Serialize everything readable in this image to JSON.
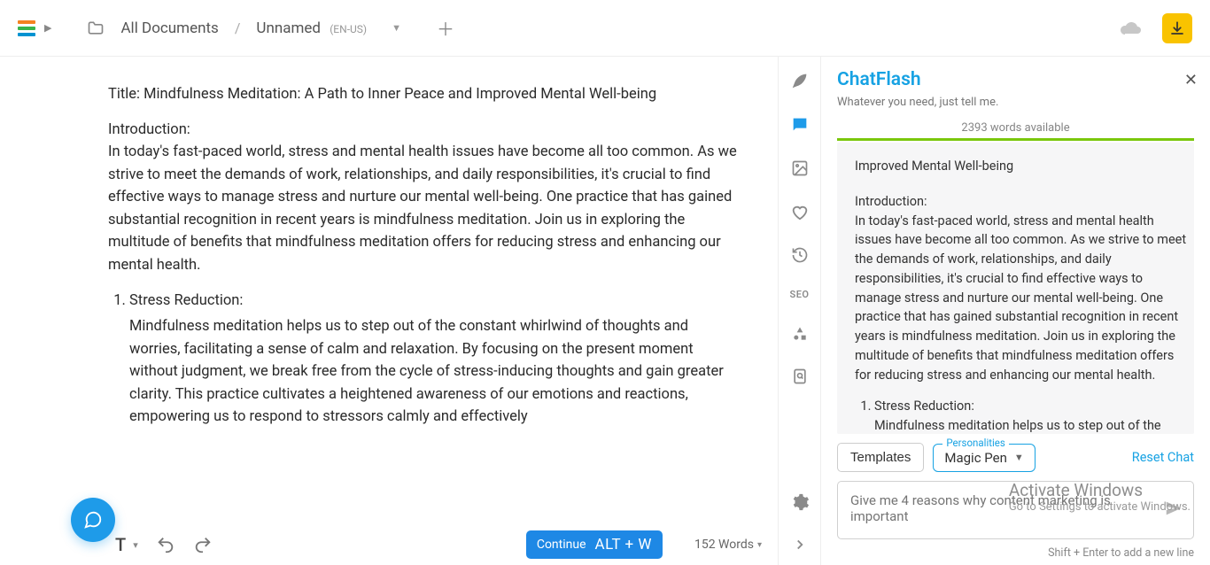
{
  "header": {
    "breadcrumb_root": "All Documents",
    "breadcrumb_current": "Unnamed",
    "lang_tag": "(EN-US)"
  },
  "editor": {
    "title_line": "Title: Mindfulness Meditation: A Path to Inner Peace and Improved Mental Well-being",
    "intro_label": "Introduction:",
    "intro_body": "In today's fast-paced world, stress and mental health issues have become all too common. As we strive to meet the demands of work, relationships, and daily responsibilities, it's crucial to find effective ways to manage stress and nurture our mental well-being. One practice that has gained substantial recognition in recent years is mindfulness meditation. Join us in exploring the multitude of benefits that mindfulness meditation offers for reducing stress and enhancing our mental health.",
    "li1_title": "Stress Reduction:",
    "li1_body": "Mindfulness meditation helps us to step out of the constant whirlwind of thoughts and worries, facilitating a sense of calm and relaxation. By focusing on the present moment without judgment, we break free from the cycle of stress-inducing thoughts and gain greater clarity. This practice cultivates a heightened awareness of our emotions and reactions, empowering us to respond to stressors calmly and effectively"
  },
  "footer": {
    "continue_label": "Continue",
    "continue_hotkey": "ALT + W",
    "word_count": "152 Words"
  },
  "panel": {
    "title": "ChatFlash",
    "subtitle": "Whatever you need, just tell me.",
    "quota": "2393 words available",
    "chat_heading": "Improved Mental Well-being",
    "intro_label": "Introduction:",
    "intro_body": "In today's fast-paced world, stress and mental health issues have become all too common. As we strive to meet the demands of work, relationships, and daily responsibilities, it's crucial to find effective ways to manage stress and nurture our mental well-being. One practice that has gained substantial recognition in recent years is mindfulness meditation. Join us in exploring the multitude of benefits that mindfulness meditation offers for reducing stress and enhancing our mental health.",
    "li1_title": "Stress Reduction:",
    "li1_body": "Mindfulness meditation helps us to step out of the constant whirlwind of thoughts and worries, facilitating a sense of calm and relaxation. By focusing on the",
    "templates_btn": "Templates",
    "magic_legend": "Personalities",
    "magic_value": "Magic Pen",
    "reset": "Reset Chat",
    "placeholder": "Give me 4 reasons why content marketing is important",
    "hint": "Shift + Enter to add a new line"
  },
  "rail": {
    "seo": "SEO"
  },
  "watermark": {
    "l1": "Activate Windows",
    "l2": "Go to Settings to activate Windows."
  }
}
